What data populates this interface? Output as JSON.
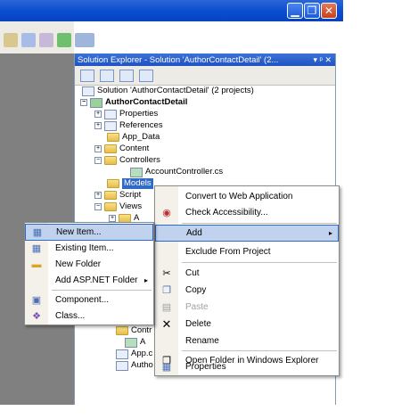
{
  "window": {
    "minimize_glyph": "▁",
    "maximize_glyph": "❐",
    "close_glyph": "✕"
  },
  "solution_explorer": {
    "title": "Solution Explorer - Solution 'AuthorContactDetail' (2...",
    "pin_glyph": "▾ ᵖ ✕"
  },
  "tree": {
    "solution": "Solution 'AuthorContactDetail' (2 projects)",
    "project": "AuthorContactDetail",
    "properties": "Properties",
    "references": "References",
    "app_data": "App_Data",
    "content": "Content",
    "controllers": "Controllers",
    "account_controller": "AccountController.cs",
    "models": "Models",
    "scripts": "Script",
    "views": "Views",
    "views_child": "A",
    "controllers2": "Contr",
    "item_a": "A",
    "app_c": "App.c",
    "author": "Autho"
  },
  "main_menu": {
    "items": [
      {
        "label": "Convert to Web Application"
      },
      {
        "label": "Check Accessibility..."
      },
      {
        "label": "Add"
      },
      {
        "label": "Exclude From Project"
      },
      {
        "label": "Cut"
      },
      {
        "label": "Copy"
      },
      {
        "label": "Paste"
      },
      {
        "label": "Delete"
      },
      {
        "label": "Rename"
      },
      {
        "label": "Open Folder in Windows Explorer"
      },
      {
        "label": "Properties"
      }
    ],
    "submenu_arrow": "▸"
  },
  "add_menu": {
    "items": [
      {
        "label": "New Item..."
      },
      {
        "label": "Existing Item..."
      },
      {
        "label": "New Folder"
      },
      {
        "label": "Add ASP.NET Folder"
      },
      {
        "label": "Component..."
      },
      {
        "label": "Class..."
      }
    ],
    "submenu_arrow": "▸"
  },
  "colors": {
    "titlebar": "#0a4fd1",
    "highlight": "#c1d2ee",
    "selection": "#316ac5"
  }
}
